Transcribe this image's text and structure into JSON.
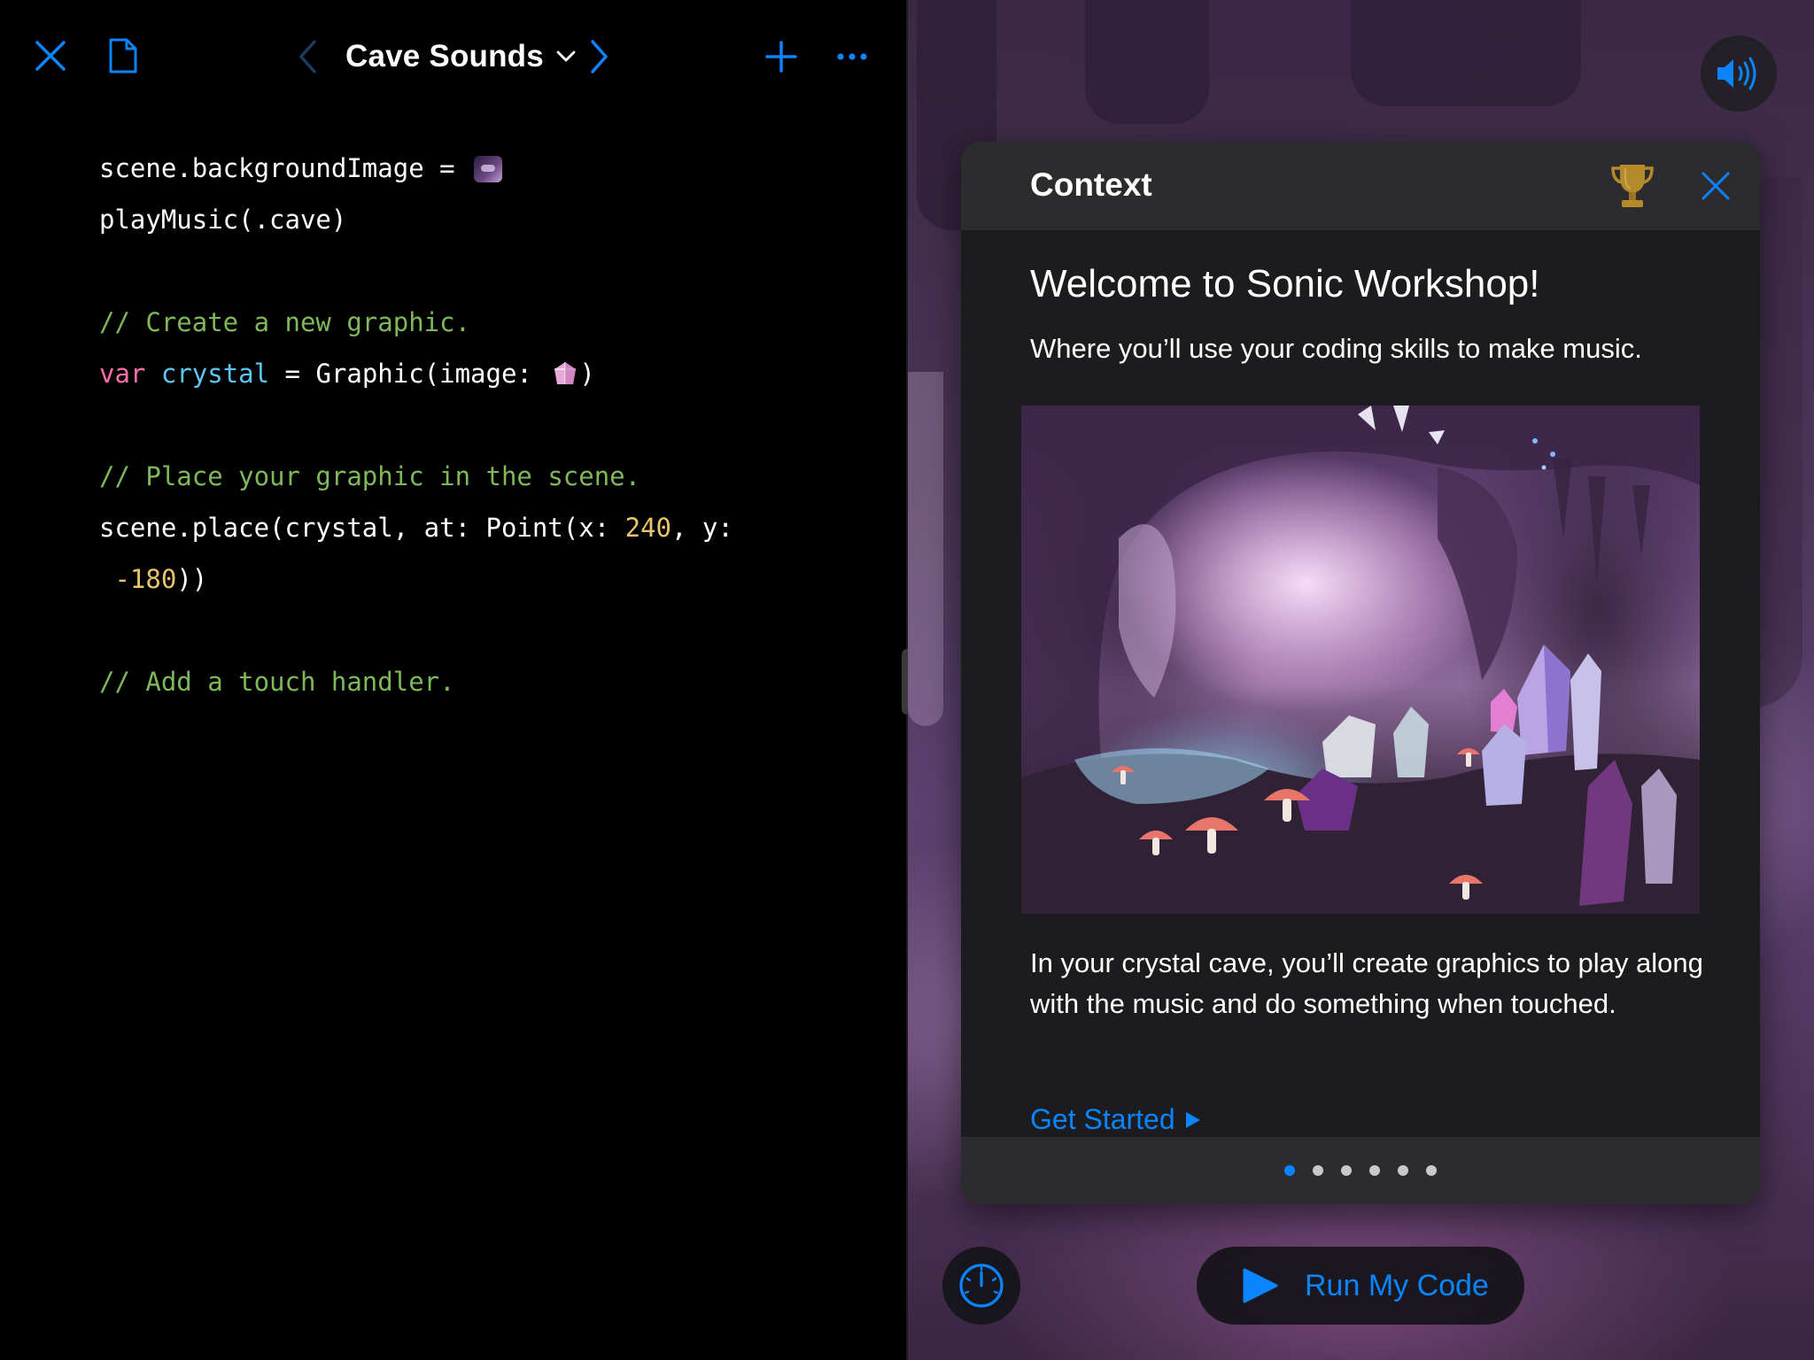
{
  "toolbar": {
    "title": "Cave Sounds"
  },
  "code": {
    "line1_a": "scene.backgroundImage = ",
    "line2": "playMusic(.cave)",
    "line3": "// Create a new graphic.",
    "line4_kw": "var",
    "line4_var": "crystal",
    "line4_rest": " = Graphic(image: ",
    "line4_end": ")",
    "line5": "// Place your graphic in the scene.",
    "line6_a": "scene.place(crystal, at: Point(x: ",
    "line6_num1": "240",
    "line6_b": ", y:",
    "line7_num": " -180",
    "line7_end": "))",
    "line8": "// Add a touch handler."
  },
  "panel": {
    "title": "Context",
    "heading": "Welcome to Sonic Workshop!",
    "subtitle": "Where you’ll use your coding skills to make music.",
    "body": "In your crystal cave, you’ll create graphics to play along with the music and do something when touched.",
    "link": "Get Started",
    "page_count": 6,
    "current_page": 1
  },
  "run_button": {
    "label": "Run My Code"
  },
  "colors": {
    "accent": "#0a84ff",
    "comment": "#7fb85a",
    "keyword": "#ff6fa8",
    "variable": "#5ec6f2",
    "number": "#e8c46a"
  },
  "icons": {
    "close": "close-icon",
    "document": "document-icon",
    "back": "chevron-left-icon",
    "forward": "chevron-right-icon",
    "add": "plus-icon",
    "more": "ellipsis-icon",
    "sound": "speaker-icon",
    "trophy": "trophy-icon",
    "speed": "speedometer-icon",
    "run": "play-icon"
  }
}
